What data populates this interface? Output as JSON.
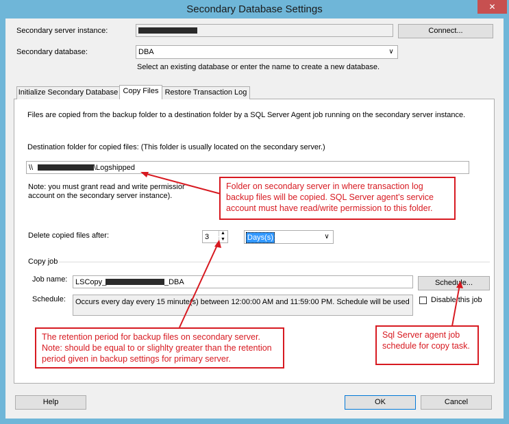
{
  "window": {
    "title": "Secondary Database Settings",
    "close_glyph": "✕"
  },
  "form": {
    "server_label": "Secondary server instance:",
    "server_value": "",
    "connect_label": "Connect...",
    "database_label": "Secondary database:",
    "database_value": "DBA",
    "database_hint": "Select an existing database or enter the name to create a new database."
  },
  "tabs": [
    {
      "label": "Initialize Secondary Database"
    },
    {
      "label": "Copy Files"
    },
    {
      "label": "Restore Transaction Log"
    }
  ],
  "copy_files": {
    "intro": "Files are copied from the backup folder to a destination folder by a SQL Server Agent job running on the secondary server instance.",
    "dest_label": "Destination folder for copied files: (This folder is usually located on the secondary server.)",
    "dest_prefix": "\\\\",
    "dest_suffix": "\\Logshipped",
    "note_line1": "Note: you must grant read and write permissior",
    "note_line2": "account on the secondary server instance).",
    "delete_label": "Delete copied files after:",
    "delete_value": "3",
    "delete_unit": "Days(s)",
    "copy_job_label": "Copy job",
    "job_name_label": "Job name:",
    "job_name_prefix": "LSCopy_",
    "job_name_suffix": "_DBA",
    "schedule_btn": "Schedule...",
    "schedule_label": "Schedule:",
    "schedule_text": "Occurs every day every 15 minute(s) between 12:00:00 AM and 11:59:00 PM. Schedule will be used",
    "disable_label": "Disable this job"
  },
  "callouts": {
    "folder": "Folder on secondary server in where transaction log backup files will be copied. SQL Server agent’s service account must have read/write permission to this folder.",
    "retention": "The retention period for backup files on secondary server. Note: should be equal to or slighlty greater than the retention period given in backup settings for primary server.",
    "schedule": "Sql Server agent job schedule for copy task."
  },
  "footer": {
    "help": "Help",
    "ok": "OK",
    "cancel": "Cancel"
  },
  "colors": {
    "callout": "#d71920",
    "title_bg": "#6fb6d8",
    "close_bg": "#c75050"
  }
}
